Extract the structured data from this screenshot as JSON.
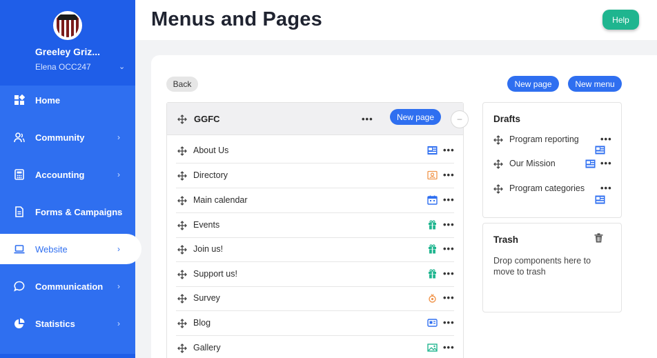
{
  "sidebar": {
    "org_name": "Greeley Griz...",
    "user_name": "Elena OCC247",
    "items": [
      {
        "label": "Home",
        "icon": "home-grid-icon",
        "has_chevron": false
      },
      {
        "label": "Community",
        "icon": "community-icon",
        "has_chevron": true
      },
      {
        "label": "Accounting",
        "icon": "accounting-icon",
        "has_chevron": true
      },
      {
        "label": "Forms & Campaigns",
        "icon": "forms-icon",
        "has_chevron": true
      },
      {
        "label": "Website",
        "icon": "laptop-icon",
        "has_chevron": true,
        "active": true
      },
      {
        "label": "Communication",
        "icon": "chat-icon",
        "has_chevron": true
      },
      {
        "label": "Statistics",
        "icon": "pie-chart-icon",
        "has_chevron": true
      }
    ],
    "chevron": "›"
  },
  "header": {
    "title": "Menus and Pages",
    "help_label": "Help"
  },
  "toolbar": {
    "back_label": "Back",
    "new_page_label": "New page",
    "new_menu_label": "New menu"
  },
  "menu": {
    "title": "GGFC",
    "new_page_label": "New page",
    "collapse_symbol": "–",
    "more_symbol": "•••",
    "items": [
      {
        "label": "About Us",
        "icon": "page-layout-icon",
        "icon_color": "#2f6ff0"
      },
      {
        "label": "Directory",
        "icon": "directory-icon",
        "icon_color": "#f0944a"
      },
      {
        "label": "Main calendar",
        "icon": "calendar-icon",
        "icon_color": "#2f6ff0"
      },
      {
        "label": "Events",
        "icon": "gift-icon",
        "icon_color": "#1fb58f"
      },
      {
        "label": "Join us!",
        "icon": "gift-icon",
        "icon_color": "#1fb58f"
      },
      {
        "label": "Support us!",
        "icon": "gift-icon",
        "icon_color": "#1fb58f"
      },
      {
        "label": "Survey",
        "icon": "survey-icon",
        "icon_color": "#f0944a"
      },
      {
        "label": "Blog",
        "icon": "blog-icon",
        "icon_color": "#2f6ff0"
      },
      {
        "label": "Gallery",
        "icon": "image-icon",
        "icon_color": "#1fb58f"
      }
    ]
  },
  "drafts": {
    "title": "Drafts",
    "items": [
      {
        "label": "Program reporting"
      },
      {
        "label": "Our Mission"
      },
      {
        "label": "Program categories"
      }
    ]
  },
  "trash": {
    "title": "Trash",
    "text": "Drop components here to move to trash"
  },
  "colors": {
    "primary": "#2f6ff0",
    "sidebar_head": "#1f5ee8",
    "help": "#1fb58f"
  }
}
